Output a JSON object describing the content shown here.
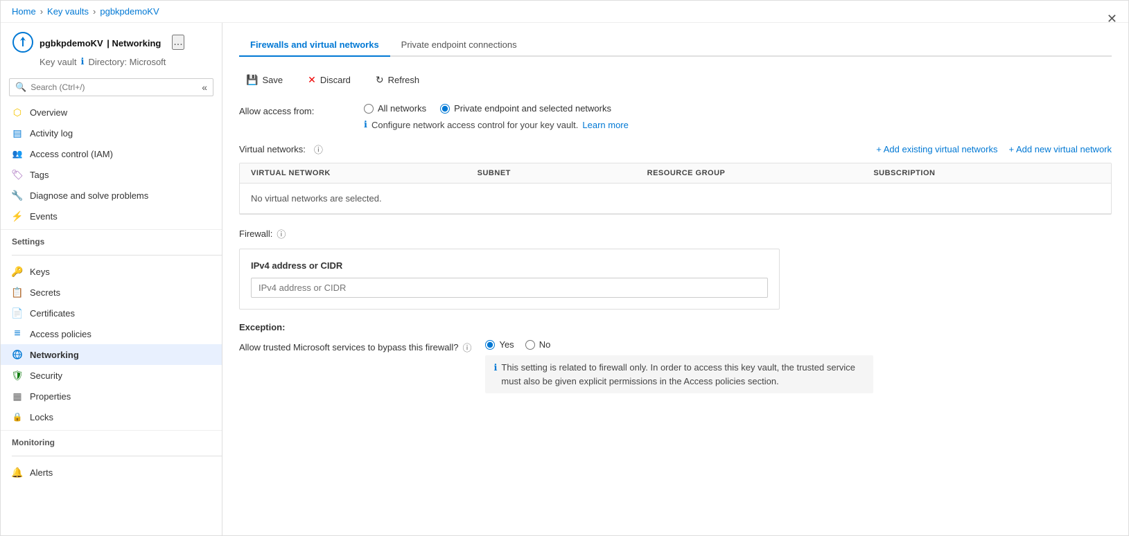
{
  "breadcrumb": {
    "home": "Home",
    "keyvaults": "Key vaults",
    "resource": "pgbkpdemoKV"
  },
  "header": {
    "resource_name": "pgbkpdemoKV",
    "separator": "|",
    "page_title": "Networking",
    "resource_type": "Key vault",
    "directory_label": "Directory: Microsoft",
    "ellipsis": "..."
  },
  "search": {
    "placeholder": "Search (Ctrl+/)"
  },
  "sidebar": {
    "items": [
      {
        "id": "overview",
        "label": "Overview",
        "icon": "⬡",
        "color": "#f5c400",
        "active": false
      },
      {
        "id": "activity-log",
        "label": "Activity log",
        "icon": "▤",
        "color": "#0078d4",
        "active": false
      },
      {
        "id": "access-control",
        "label": "Access control (IAM)",
        "icon": "👥",
        "color": "#0078d4",
        "active": false
      },
      {
        "id": "tags",
        "label": "Tags",
        "icon": "🏷",
        "color": "#9b59b6",
        "active": false
      },
      {
        "id": "diagnose",
        "label": "Diagnose and solve problems",
        "icon": "🔧",
        "color": "#666",
        "active": false
      },
      {
        "id": "events",
        "label": "Events",
        "icon": "⚡",
        "color": "#f5c400",
        "active": false
      }
    ],
    "settings_section": "Settings",
    "settings_items": [
      {
        "id": "keys",
        "label": "Keys",
        "icon": "🔑",
        "color": "#f5c400",
        "active": false
      },
      {
        "id": "secrets",
        "label": "Secrets",
        "icon": "📋",
        "color": "#f5a623",
        "active": false
      },
      {
        "id": "certificates",
        "label": "Certificates",
        "icon": "📄",
        "color": "#f5a623",
        "active": false
      },
      {
        "id": "access-policies",
        "label": "Access policies",
        "icon": "≡",
        "color": "#0078d4",
        "active": false
      },
      {
        "id": "networking",
        "label": "Networking",
        "icon": "⟳",
        "color": "#0078d4",
        "active": true
      },
      {
        "id": "security",
        "label": "Security",
        "icon": "🛡",
        "color": "#107c10",
        "active": false
      },
      {
        "id": "properties",
        "label": "Properties",
        "icon": "▦",
        "color": "#666",
        "active": false
      },
      {
        "id": "locks",
        "label": "Locks",
        "icon": "🔒",
        "color": "#0078d4",
        "active": false
      }
    ],
    "monitoring_section": "Monitoring",
    "monitoring_items": [
      {
        "id": "alerts",
        "label": "Alerts",
        "icon": "🔔",
        "color": "#f5a623",
        "active": false
      }
    ]
  },
  "tabs": [
    {
      "id": "firewalls",
      "label": "Firewalls and virtual networks",
      "active": true
    },
    {
      "id": "private-endpoints",
      "label": "Private endpoint connections",
      "active": false
    }
  ],
  "toolbar": {
    "save": "Save",
    "discard": "Discard",
    "refresh": "Refresh"
  },
  "allow_access": {
    "label": "Allow access from:",
    "option_all": "All networks",
    "option_private": "Private endpoint and selected networks",
    "selected": "private",
    "info_text": "Configure network access control for your key vault.",
    "learn_more": "Learn more"
  },
  "virtual_networks": {
    "label": "Virtual networks:",
    "add_existing": "+ Add existing virtual networks",
    "add_new": "+ Add new virtual network",
    "columns": [
      "VIRTUAL NETWORK",
      "SUBNET",
      "RESOURCE GROUP",
      "SUBSCRIPTION"
    ],
    "empty_text": "No virtual networks are selected."
  },
  "firewall": {
    "label": "Firewall:",
    "box_title": "IPv4 address or CIDR",
    "input_placeholder": "IPv4 address or CIDR"
  },
  "exception": {
    "label": "Exception:",
    "bypass_label": "Allow trusted Microsoft services to bypass this firewall?",
    "option_yes": "Yes",
    "option_no": "No",
    "selected": "yes",
    "info_text": "This setting is related to firewall only. In order to access this key vault, the trusted service must also be given explicit permissions in the Access policies section."
  }
}
